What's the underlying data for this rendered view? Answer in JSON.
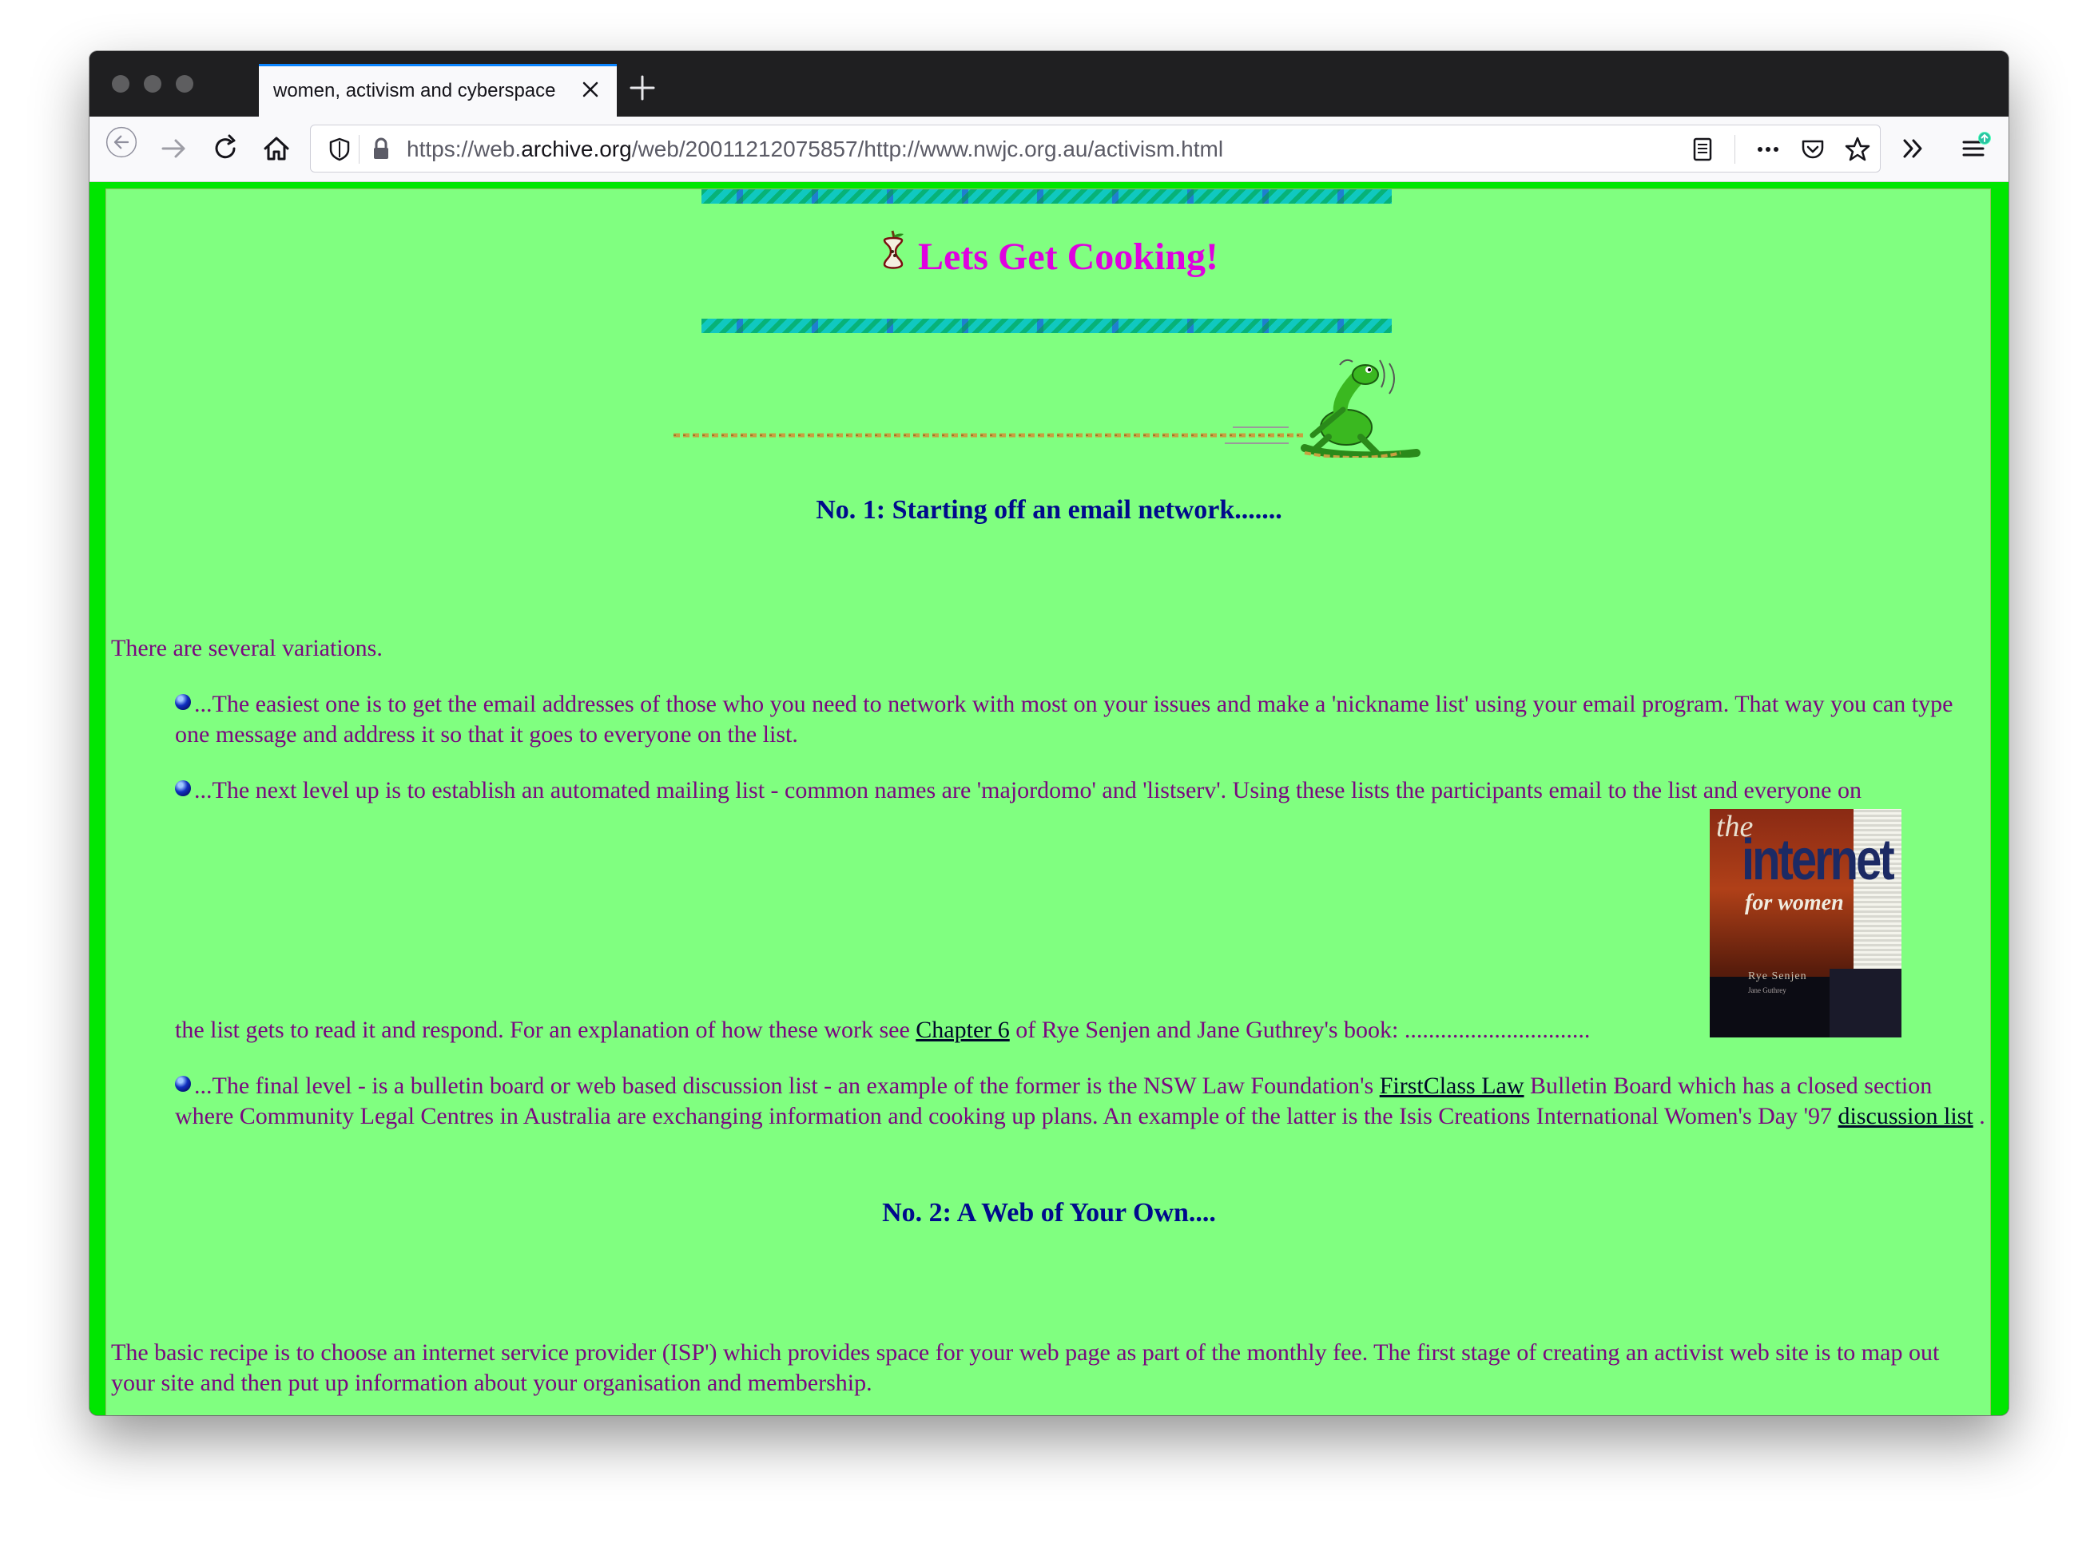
{
  "browser": {
    "tab_title": "women, activism and cyberspace",
    "url_prefix": "https://web.",
    "url_domain": "archive.org",
    "url_suffix": "/web/20011212075857/http://www.nwjc.org.au/activism.html"
  },
  "page": {
    "title": "Lets Get Cooking!",
    "section1_heading": "No. 1: Starting off an email network.......",
    "intro": "There are several variations.",
    "item1": "...The easiest one is to get the email addresses of those who you need to network with most on your issues and make a 'nickname list' using your email program. That way you can type one message and address it so that it goes to everyone on the list.",
    "item2_line1": "...The next level up is to establish an automated mailing list - common names are 'majordomo' and 'listserv'. Using these lists the participants email to the list and everyone on",
    "item2_line2_before": "the list gets to read it and respond. For an explanation of how these work see ",
    "item2_link": "Chapter 6",
    "item2_line2_after": " of Rye Senjen and Jane Guthrey's book: ...............................",
    "item3_before": "...The final level - is a bulletin board or web based discussion list - an example of the former is the NSW Law Foundation's ",
    "item3_link1": "FirstClass Law",
    "item3_middle": " Bulletin Board which has a closed section where Community Legal Centres in Australia are exchanging information and cooking up plans. An example of the latter is the Isis Creations International Women's Day '97 ",
    "item3_link2": "discussion list",
    "item3_after": " .",
    "section2_heading": "No. 2: A Web of Your Own....",
    "para_last": "The basic recipe is to choose an internet service provider (ISP') which provides space for your web page as part of the monthly fee. The first stage of creating an activist web site is to map out your site and then put up information about your organisation and membership.",
    "book_cover": {
      "line1": "the",
      "line2": "internet",
      "line3": "for women",
      "author": "Rye Senjen",
      "coauthor": "Jane Guthrey"
    }
  },
  "colors": {
    "page_bg": "#80ff80",
    "page_border": "#00e600",
    "text": "#7a0880",
    "heading": "#000a8c",
    "title": "#e000e0"
  }
}
